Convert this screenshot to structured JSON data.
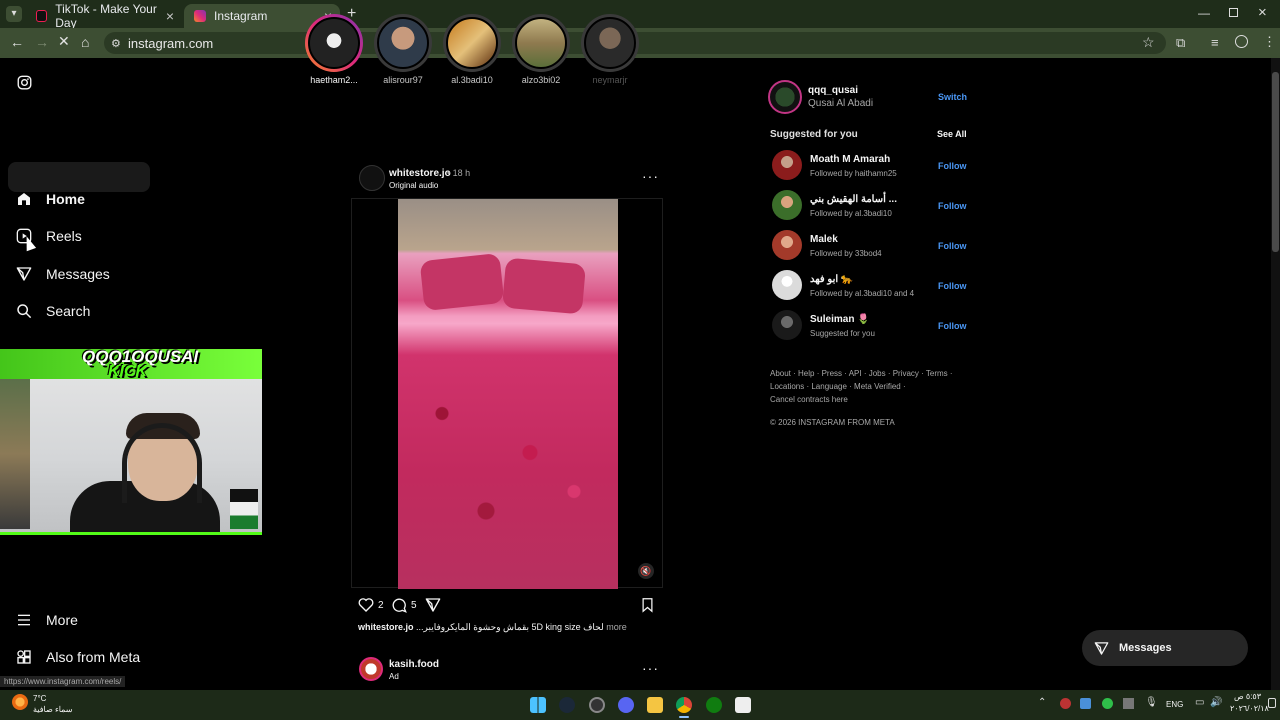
{
  "browser": {
    "tabs": [
      {
        "title": "TikTok - Make Your Day"
      },
      {
        "title": "Instagram"
      }
    ],
    "url": "instagram.com",
    "status_url": "https://www.instagram.com/reels/"
  },
  "sidebar": {
    "items": [
      {
        "label": "Home"
      },
      {
        "label": "Reels"
      },
      {
        "label": "Messages"
      },
      {
        "label": "Search"
      }
    ],
    "more_label": "More",
    "meta_label": "Also from Meta"
  },
  "stories": [
    {
      "name": "haetham2..."
    },
    {
      "name": "alisrour97"
    },
    {
      "name": "al.3badi10"
    },
    {
      "name": "alzo3bi02"
    },
    {
      "name": "neymarjr"
    }
  ],
  "post": {
    "username": "whitestore.jo",
    "time": "• 18 h",
    "audio": "Original audio",
    "likes": "2",
    "comments": "5",
    "caption_user": "whitestore.jo",
    "caption_text": "لحاف 5D king size بقماش وحشوة المايكروفايبر...",
    "more": "more"
  },
  "next_post": {
    "username": "kasih.food",
    "label": "Ad"
  },
  "profile": {
    "username": "qqq_qusai",
    "full_name": "Qusai Al Abadi",
    "switch": "Switch"
  },
  "suggested": {
    "title": "Suggested for you",
    "see_all": "See All",
    "follow": "Follow",
    "items": [
      {
        "name": "Moath M Amarah",
        "sub": "Followed by haithamn25"
      },
      {
        "name": "أسامة الهقيش بني ...",
        "sub": "Followed by al.3badi10"
      },
      {
        "name": "Malek",
        "sub": "Followed by 33bod4"
      },
      {
        "name": "ابو فهد 🐆",
        "sub": "Followed by al.3badi10 and 4"
      },
      {
        "name": "Suleiman 🌷",
        "sub": "Suggested for you"
      }
    ]
  },
  "footer": {
    "line1": "About · Help · Press · API · Jobs · Privacy · Terms ·",
    "line2": "Locations · Language · Meta Verified ·",
    "line3": "Cancel contracts here",
    "copyright": "© 2026 INSTAGRAM FROM META"
  },
  "messages_button": "Messages",
  "webcam": {
    "overlay_line1": "QQQ1OQUSAI",
    "overlay_line2": "KICK"
  },
  "taskbar": {
    "weather_temp": "7°C",
    "weather_desc": "سماء صافية",
    "lang": "ENG",
    "time": "٥:٥٣ ص",
    "date": "٢٠٢٦/٠٢/١٨"
  }
}
